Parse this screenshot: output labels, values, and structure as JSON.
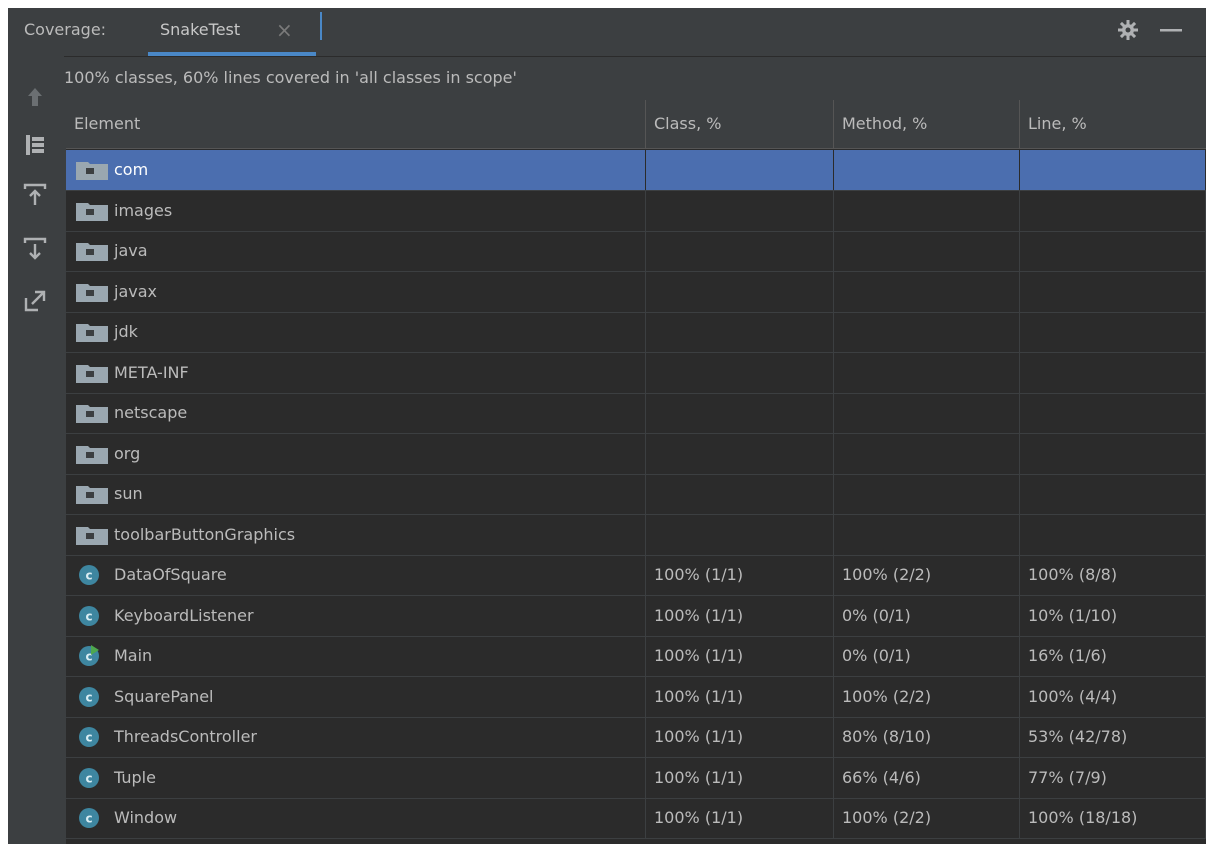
{
  "header": {
    "label": "Coverage:",
    "tab_label": "SnakeTest",
    "close_glyph": "×",
    "settings_icon": "gear-icon",
    "minimize_icon": "minus-icon"
  },
  "summary": "100% classes, 60% lines covered in 'all classes in scope'",
  "table": {
    "columns": [
      "Element",
      "Class, %",
      "Method, %",
      "Line, %"
    ],
    "rows": [
      {
        "name": "com",
        "type": "package",
        "class": "",
        "method": "",
        "line": "",
        "selected": true
      },
      {
        "name": "images",
        "type": "package",
        "class": "",
        "method": "",
        "line": ""
      },
      {
        "name": "java",
        "type": "package",
        "class": "",
        "method": "",
        "line": ""
      },
      {
        "name": "javax",
        "type": "package",
        "class": "",
        "method": "",
        "line": ""
      },
      {
        "name": "jdk",
        "type": "package",
        "class": "",
        "method": "",
        "line": ""
      },
      {
        "name": "META-INF",
        "type": "package",
        "class": "",
        "method": "",
        "line": ""
      },
      {
        "name": "netscape",
        "type": "package",
        "class": "",
        "method": "",
        "line": ""
      },
      {
        "name": "org",
        "type": "package",
        "class": "",
        "method": "",
        "line": ""
      },
      {
        "name": "sun",
        "type": "package",
        "class": "",
        "method": "",
        "line": ""
      },
      {
        "name": "toolbarButtonGraphics",
        "type": "package",
        "class": "",
        "method": "",
        "line": ""
      },
      {
        "name": "DataOfSquare",
        "type": "class",
        "class": "100% (1/1)",
        "method": "100% (2/2)",
        "line": "100% (8/8)"
      },
      {
        "name": "KeyboardListener",
        "type": "class",
        "class": "100% (1/1)",
        "method": "0% (0/1)",
        "line": "10% (1/10)"
      },
      {
        "name": "Main",
        "type": "main-class",
        "class": "100% (1/1)",
        "method": "0% (0/1)",
        "line": "16% (1/6)"
      },
      {
        "name": "SquarePanel",
        "type": "class",
        "class": "100% (1/1)",
        "method": "100% (2/2)",
        "line": "100% (4/4)"
      },
      {
        "name": "ThreadsController",
        "type": "class",
        "class": "100% (1/1)",
        "method": "80% (8/10)",
        "line": "53% (42/78)"
      },
      {
        "name": "Tuple",
        "type": "class",
        "class": "100% (1/1)",
        "method": "66% (4/6)",
        "line": "77% (7/9)"
      },
      {
        "name": "Window",
        "type": "class",
        "class": "100% (1/1)",
        "method": "100% (2/2)",
        "line": "100% (18/18)"
      }
    ]
  },
  "toolbar": {
    "items": [
      "up-arrow-icon",
      "flatten-packages-icon",
      "import-icon",
      "export-icon",
      "generate-report-icon"
    ]
  },
  "colors": {
    "background": "#3c3f41",
    "table_bg": "#2b2b2b",
    "selection": "#4b6eaf",
    "accent": "#4a88c7",
    "class_icon": "#3e86a0"
  }
}
